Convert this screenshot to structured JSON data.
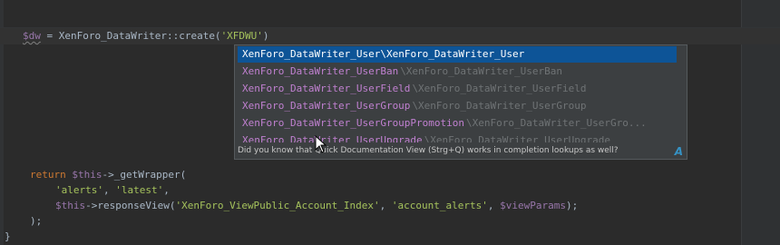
{
  "editor": {
    "line1": {
      "var": "$dw",
      "eq": " = ",
      "call": "XenForo_DataWriter::create(",
      "arg": "'XFDWU'",
      "close": ")"
    },
    "line_return": {
      "kw": "return",
      "this": "$this",
      "call": "->_getWrapper("
    },
    "line_args": {
      "a1": "'alerts'",
      "sep": ", ",
      "a2": "'latest'",
      "end": ","
    },
    "line_response": {
      "this": "$this",
      "call": "->responseView(",
      "a1": "'XenForo_ViewPublic_Account_Index'",
      "sep1": ", ",
      "a2": "'account_alerts'",
      "sep2": ", ",
      "a3": "$viewParams",
      "close": ");"
    },
    "line_close": ");",
    "line_brace": "}"
  },
  "completion": {
    "items": [
      {
        "name": "XenForo_DataWriter_User",
        "tail": "\\XenForo_DataWriter_User",
        "selected": true
      },
      {
        "name": "XenForo_DataWriter_UserBan",
        "tail": "\\XenForo_DataWriter_UserBan"
      },
      {
        "name": "XenForo_DataWriter_UserField",
        "tail": "\\XenForo_DataWriter_UserField"
      },
      {
        "name": "XenForo_DataWriter_UserGroup",
        "tail": "\\XenForo_DataWriter_UserGroup"
      },
      {
        "name": "XenForo_DataWriter_UserGroupPromotion",
        "tail": "\\XenForo_DataWriter_UserGro..."
      },
      {
        "name": "XenForo_DataWriter_UserUpgrade",
        "tail": "\\XenForo_DataWriter_UserUpgrade"
      }
    ],
    "hint": "Did you know that Quick Documentation View (Strg+Q) works in completion lookups as well?",
    "hint_icon": "A",
    "colors": {
      "selection": "#0d5497",
      "class_name": "#c080d0",
      "namespace_tail": "#6f7375",
      "background": "#3c3f41"
    }
  },
  "colors": {
    "editor_bg": "#2b2b2b",
    "variable": "#9876aa",
    "string": "#a5c25c",
    "keyword": "#cc7832",
    "default_text": "#a9b7c6"
  },
  "icons": [
    "mouse-pointer-icon",
    "text-completion-icon"
  ]
}
